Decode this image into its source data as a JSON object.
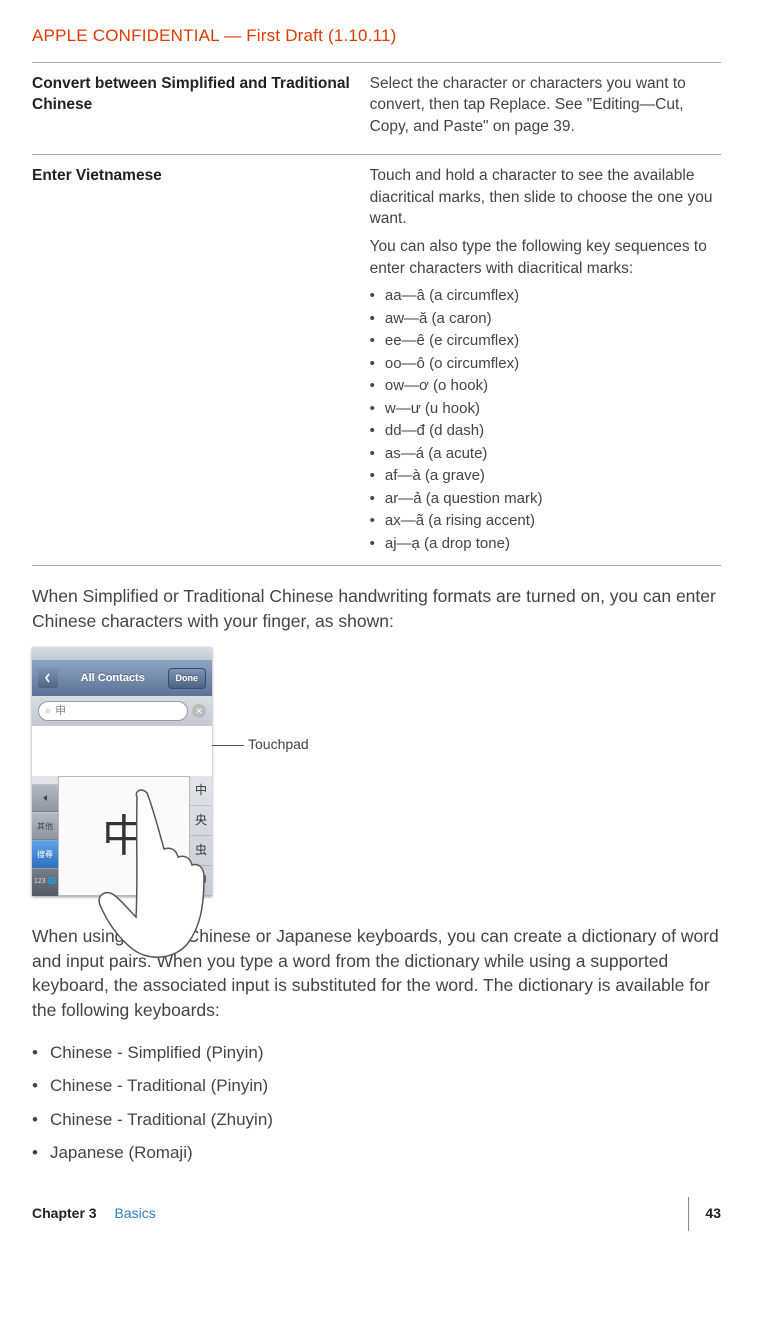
{
  "header": {
    "confidential": "APPLE CONFIDENTIAL  —  First Draft (1.10.11)"
  },
  "table": {
    "rows": [
      {
        "left": "Convert between Simplified and Traditional Chinese",
        "right_paras": [
          "Select the character or characters you want to convert, then tap Replace. See \"Editing—Cut, Copy, and Paste\" on page 39."
        ]
      },
      {
        "left": "Enter Vietnamese",
        "right_paras": [
          "Touch and hold a character to see the available diacritical marks, then slide to choose the one you want.",
          "You can also type the following key sequences to enter characters with diacritical marks:"
        ],
        "list": [
          "aa—â (a circumflex)",
          "aw—ă (a caron)",
          "ee—ê (e circumflex)",
          "oo—ô (o circumflex)",
          "ow—ơ (o hook)",
          "w—ư (u hook)",
          "dd—đ (d dash)",
          "as—á (a acute)",
          "af—à (a grave)",
          "ar—ả (a question mark)",
          "ax—ã (a rising accent)",
          "aj—ạ (a drop tone)"
        ]
      }
    ]
  },
  "para1": "When Simplified or Traditional Chinese handwriting formats are turned on, you can enter Chinese characters with your finger, as shown:",
  "figure": {
    "navbar_title": "All Contacts",
    "navbar_done": "Done",
    "search_char": "申",
    "handwriting_char": "中",
    "candidates": [
      "中",
      "央",
      "虫",
      "申"
    ],
    "kb_123": "123",
    "callout": "Touchpad"
  },
  "para2": "When using certain Chinese or Japanese keyboards, you can create a dictionary of word and input pairs. When you type a word from the dictionary while using a supported keyboard, the associated input is substituted for the word. The dictionary is available for the following keyboards:",
  "keyboards": [
    "Chinese - Simplified (Pinyin)",
    "Chinese - Traditional (Pinyin)",
    "Chinese - Traditional (Zhuyin)",
    "Japanese (Romaji)"
  ],
  "footer": {
    "chapter_label": "Chapter 3",
    "chapter_title": "Basics",
    "page_no": "43"
  }
}
